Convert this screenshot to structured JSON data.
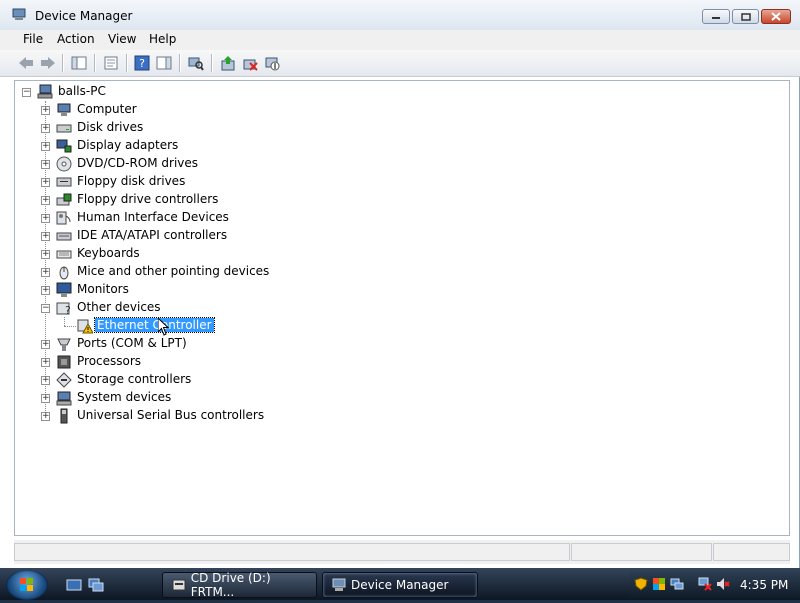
{
  "window": {
    "title": "Device Manager"
  },
  "menu": [
    "File",
    "Action",
    "View",
    "Help"
  ],
  "tree": {
    "root": "balls-PC",
    "categories": [
      {
        "label": "Computer",
        "icon": "computer-icon"
      },
      {
        "label": "Disk drives",
        "icon": "disk-drive-icon"
      },
      {
        "label": "Display adapters",
        "icon": "display-adapter-icon"
      },
      {
        "label": "DVD/CD-ROM drives",
        "icon": "dvd-icon"
      },
      {
        "label": "Floppy disk drives",
        "icon": "floppy-icon"
      },
      {
        "label": "Floppy drive controllers",
        "icon": "floppy-controller-icon"
      },
      {
        "label": "Human Interface Devices",
        "icon": "hid-icon"
      },
      {
        "label": "IDE ATA/ATAPI controllers",
        "icon": "ide-icon"
      },
      {
        "label": "Keyboards",
        "icon": "keyboard-icon"
      },
      {
        "label": "Mice and other pointing devices",
        "icon": "mouse-icon"
      },
      {
        "label": "Monitors",
        "icon": "monitor-icon"
      },
      {
        "label": "Other devices",
        "icon": "unknown-device-icon",
        "expanded": true,
        "children": [
          {
            "label": "Ethernet Controller",
            "icon": "warning-device-icon",
            "selected": true
          }
        ]
      },
      {
        "label": "Ports (COM & LPT)",
        "icon": "port-icon"
      },
      {
        "label": "Processors",
        "icon": "processor-icon"
      },
      {
        "label": "Storage controllers",
        "icon": "storage-icon"
      },
      {
        "label": "System devices",
        "icon": "system-icon"
      },
      {
        "label": "Universal Serial Bus controllers",
        "icon": "usb-icon"
      }
    ]
  },
  "taskbar": {
    "tasks": [
      "CD Drive (D:) FRTM...",
      "Device Manager"
    ],
    "clock": "4:35 PM"
  },
  "colors": {
    "selection": "#3399ff",
    "taskbar": "#1f3147"
  }
}
